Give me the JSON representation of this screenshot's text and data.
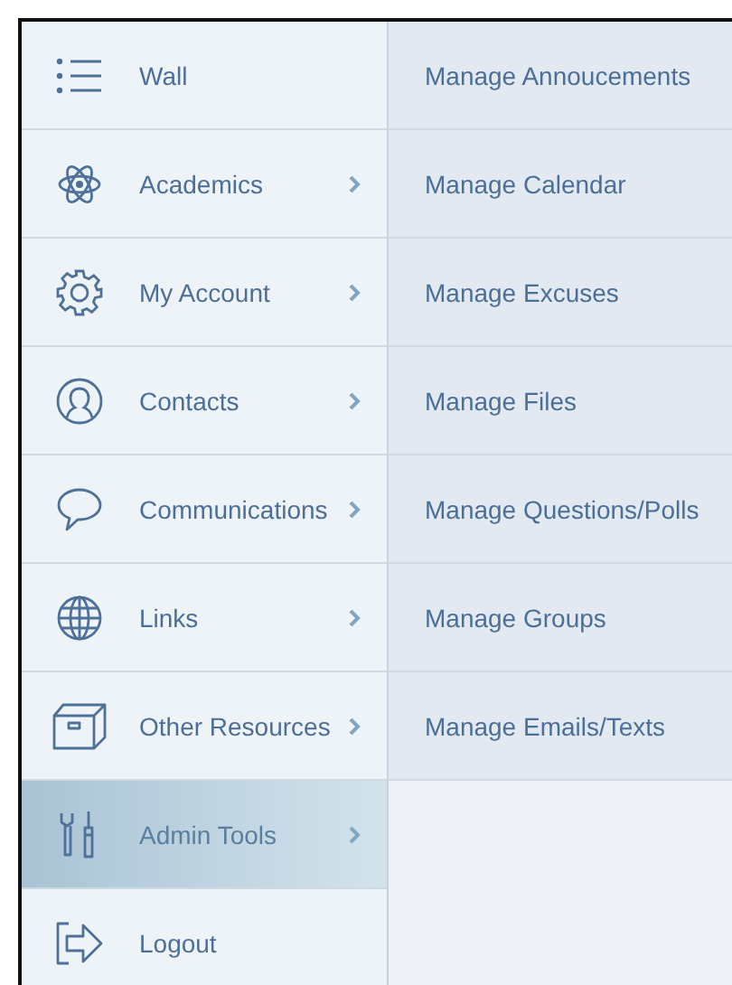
{
  "menu": {
    "items": [
      {
        "label": "Wall",
        "kind": "list",
        "has_submenu": false,
        "selected": false
      },
      {
        "label": "Academics",
        "kind": "atom",
        "has_submenu": true,
        "selected": false
      },
      {
        "label": "My Account",
        "kind": "gear",
        "has_submenu": true,
        "selected": false
      },
      {
        "label": "Contacts",
        "kind": "person",
        "has_submenu": true,
        "selected": false
      },
      {
        "label": "Communications",
        "kind": "speech",
        "has_submenu": true,
        "selected": false
      },
      {
        "label": "Links",
        "kind": "globe",
        "has_submenu": true,
        "selected": false
      },
      {
        "label": "Other Resources",
        "kind": "box",
        "has_submenu": true,
        "selected": false
      },
      {
        "label": "Admin Tools",
        "kind": "tools",
        "has_submenu": true,
        "selected": true
      },
      {
        "label": "Logout",
        "kind": "logout",
        "has_submenu": false,
        "selected": false
      }
    ]
  },
  "submenu": {
    "items": [
      {
        "label": "Manage Annoucements"
      },
      {
        "label": "Manage Calendar"
      },
      {
        "label": "Manage Excuses"
      },
      {
        "label": "Manage Files"
      },
      {
        "label": "Manage Questions/Polls"
      },
      {
        "label": "Manage Groups"
      },
      {
        "label": "Manage Emails/Texts"
      }
    ]
  }
}
